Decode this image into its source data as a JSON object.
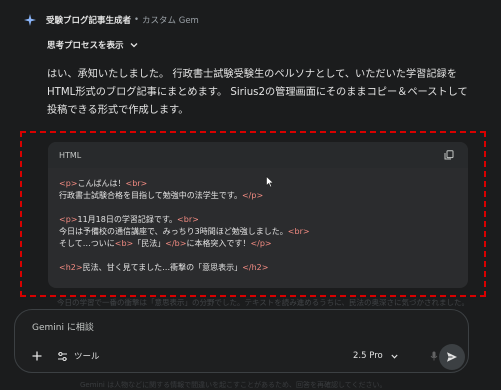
{
  "header": {
    "gem_name": "受験ブログ記事生成者",
    "separator": "•",
    "gem_type": "カスタム Gem"
  },
  "thinking": {
    "label": "思考プロセスを表示"
  },
  "response": {
    "text": "はい、承知いたしました。 行政書士試験受験生のペルソナとして、いただいた学習記録をHTML形式のブログ記事にまとめます。 Sirius2の管理画面にそのままコピー＆ペーストして投稿できる形式で作成します。"
  },
  "code_block": {
    "language": "HTML",
    "lines": [
      [
        {
          "t": "tag",
          "v": "<p>"
        },
        {
          "t": "txt",
          "v": "こんばんは！"
        },
        {
          "t": "tag",
          "v": "<br>"
        }
      ],
      [
        {
          "t": "txt",
          "v": "行政書士試験合格を目指して勉強中の法学生です。"
        },
        {
          "t": "tag",
          "v": "</p>"
        }
      ],
      [],
      [
        {
          "t": "tag",
          "v": "<p>"
        },
        {
          "t": "txt",
          "v": "11月18日の学習記録です。"
        },
        {
          "t": "tag",
          "v": "<br>"
        }
      ],
      [
        {
          "t": "txt",
          "v": "今日は予備校の通信講座で、みっちり3時間ほど勉強しました。"
        },
        {
          "t": "tag",
          "v": "<br>"
        }
      ],
      [
        {
          "t": "txt",
          "v": "そして…ついに"
        },
        {
          "t": "tag",
          "v": "<b>"
        },
        {
          "t": "txt",
          "v": "「民法」"
        },
        {
          "t": "tag",
          "v": "</b>"
        },
        {
          "t": "txt",
          "v": "に本格突入です！"
        },
        {
          "t": "tag",
          "v": "</p>"
        }
      ],
      [],
      [
        {
          "t": "tag",
          "v": "<h2>"
        },
        {
          "t": "txt",
          "v": "民法、甘く見てました…衝撃の「意思表示」"
        },
        {
          "t": "tag",
          "v": "</h2>"
        }
      ]
    ]
  },
  "faded_line": "今日の学習で一番の衝撃は「意思表示」の分野でした。テキストを読み進めるうちに、民法の奥深さに気づかされました。",
  "prompt": {
    "placeholder": "Gemini に相談",
    "tools_label": "ツール",
    "model_label": "2.5 Pro"
  },
  "bottom_faded": "Gemini は人物などに関する情報で間違いを起こすことがあるため、回答を再確認してください。"
}
